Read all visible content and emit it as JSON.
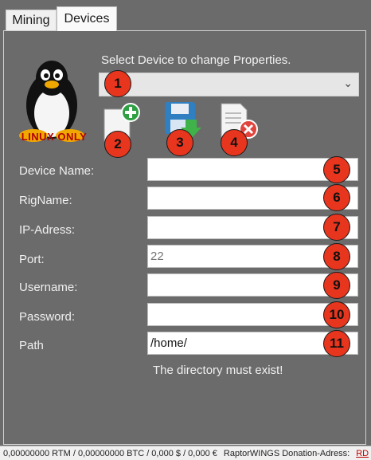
{
  "tabs": [
    {
      "label": "Mining",
      "active": false
    },
    {
      "label": "Devices",
      "active": true
    }
  ],
  "logo": {
    "text": "LINUX ONLY"
  },
  "device_select": {
    "label": "Select Device to change Properties.",
    "value": ""
  },
  "toolbar": {
    "add_icon": "add-document-icon",
    "save_icon": "save-floppy-icon",
    "delete_icon": "delete-document-icon"
  },
  "badges": [
    "1",
    "2",
    "3",
    "4",
    "5",
    "6",
    "7",
    "8",
    "9",
    "10",
    "11"
  ],
  "fields": [
    {
      "label": "Device Name:",
      "value": "",
      "placeholder": ""
    },
    {
      "label": "RigName:",
      "value": "",
      "placeholder": ""
    },
    {
      "label": "IP-Adress:",
      "value": "",
      "placeholder": ""
    },
    {
      "label": "Port:",
      "value": "",
      "placeholder": "22"
    },
    {
      "label": "Username:",
      "value": "",
      "placeholder": ""
    },
    {
      "label": "Password:",
      "value": "",
      "placeholder": ""
    },
    {
      "label": "Path",
      "value": "/home/",
      "placeholder": ""
    }
  ],
  "hint": "The directory must exist!",
  "statusbar": {
    "balance": "0,00000000 RTM / 0,00000000 BTC / 0,000 $ / 0,000 €",
    "donation_label": "RaptorWINGS Donation-Adress:",
    "donation_link": "RD"
  },
  "colors": {
    "badge": "#e7351e",
    "background": "#6b6b6b",
    "link": "#c00000"
  }
}
